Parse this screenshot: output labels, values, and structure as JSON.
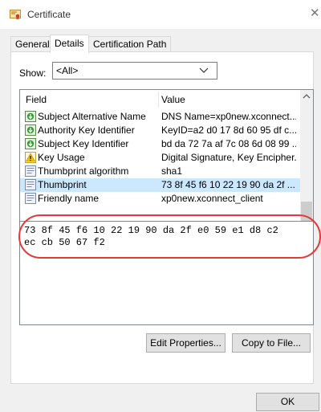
{
  "window": {
    "title": "Certificate"
  },
  "tabs": [
    {
      "label": "General",
      "selected": false
    },
    {
      "label": "Details",
      "selected": true
    },
    {
      "label": "Certification Path",
      "selected": false
    }
  ],
  "show": {
    "label": "Show:",
    "selected": "<All>"
  },
  "list": {
    "columns": [
      "Field",
      "Value"
    ],
    "rows": [
      {
        "field": "Subject Alternative Name",
        "value": "DNS Name=xp0new.xconnect...",
        "icon": "cert-extension-icon"
      },
      {
        "field": "Authority Key Identifier",
        "value": "KeyID=a2 d0 17 8d 60 95 df c...",
        "icon": "cert-extension-icon"
      },
      {
        "field": "Subject Key Identifier",
        "value": "bd da 72 7a af 7c 08 6d 08 99 ...",
        "icon": "cert-extension-icon"
      },
      {
        "field": "Key Usage",
        "value": "Digital Signature, Key Encipher...",
        "icon": "warning-icon"
      },
      {
        "field": "Thumbprint algorithm",
        "value": "sha1",
        "icon": "property-icon"
      },
      {
        "field": "Thumbprint",
        "value": "73 8f 45 f6 10 22 19 90 da 2f ...",
        "icon": "property-icon",
        "selected": true
      },
      {
        "field": "Friendly name",
        "value": "xp0new.xconnect_client",
        "icon": "property-icon"
      }
    ]
  },
  "detail": {
    "text": "73 8f 45 f6 10 22 19 90 da 2f e0 59 e1 d8 c2\nec cb 50 67 f2"
  },
  "buttons": {
    "edit_properties": "Edit Properties...",
    "copy_to_file": "Copy to File...",
    "ok": "OK"
  },
  "colors": {
    "selection": "#cce8ff",
    "highlight": "#e23a3a"
  }
}
